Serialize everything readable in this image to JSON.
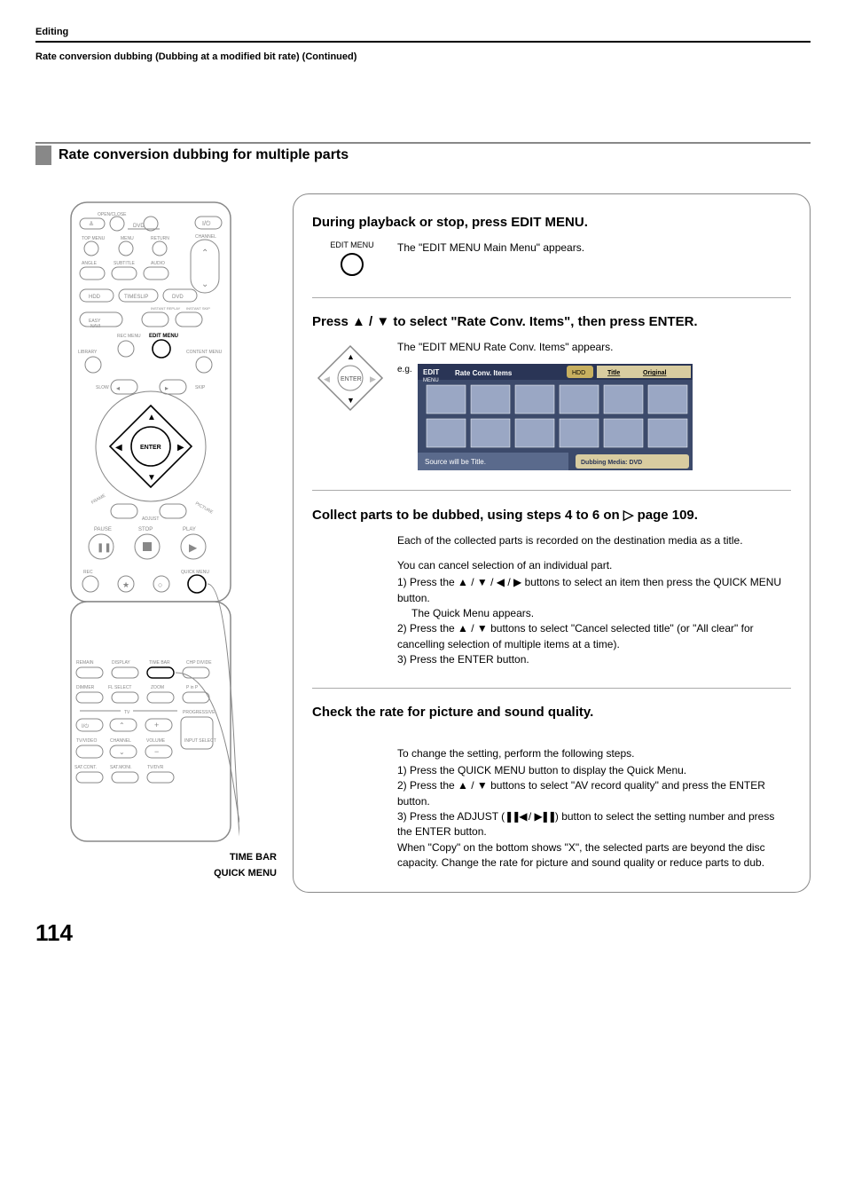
{
  "header": {
    "section": "Editing",
    "subtitle": "Rate conversion dubbing (Dubbing at a modified bit rate) (Continued)"
  },
  "mainHeading": "Rate conversion dubbing for multiple parts",
  "callouts": {
    "timeBar": "TIME BAR",
    "quickMenu": "QUICK MENU"
  },
  "remote": {
    "openClose": "OPEN/CLOSE",
    "dvd": "DVD",
    "topMenu": "TOP MENU",
    "menu": "MENU",
    "return": "RETURN",
    "angle": "ANGLE",
    "subtitle": "SUBTITLE",
    "audio": "AUDIO",
    "channel": "CHANNEL",
    "hdd": "HDD",
    "timeslip": "TIMESLIP",
    "dvd2": "DVD",
    "instantReplay": "INSTANT REPLAY",
    "instantSkip": "INSTANT SKIP",
    "easyNavi": "EASY NAVI",
    "recMenu": "REC MENU",
    "editMenu": "EDIT MENU",
    "library": "LIBRARY",
    "contentMenu": "CONTENT MENU",
    "slow": "SLOW",
    "skip": "SKIP",
    "enter": "ENTER",
    "frame": "FRAME",
    "adjust": "ADJUST",
    "pictureSearch": "PICTURE SEARCH",
    "pause": "PAUSE",
    "stop": "STOP",
    "play": "PLAY",
    "rec": "REC",
    "quickMenuBtn": "QUICK MENU",
    "remain": "REMAIN",
    "display": "DISPLAY",
    "timeBarBtn": "TIME BAR",
    "chpDivide": "CHP DIVIDE",
    "dimmer": "DIMMER",
    "flSelect": "FL SELECT",
    "zoom": "ZOOM",
    "pinp": "P in P",
    "tv": "TV",
    "progressive": "PROGRESSIVE",
    "tvVideo": "TV/VIDEO",
    "channel2": "CHANNEL",
    "volume": "VOLUME",
    "inputSelect": "INPUT SELECT",
    "satCont": "SAT.CONT.",
    "satMoni": "SAT.MONI.",
    "tvDvr": "TV/DVR"
  },
  "steps": [
    {
      "heading": "During playback or stop, press EDIT MENU.",
      "visualLabel": "EDIT MENU",
      "body": "The \"EDIT MENU Main Menu\" appears."
    },
    {
      "heading": "Press ▲ / ▼ to select \"Rate Conv. Items\", then press ENTER.",
      "visualLabel": "ENTER",
      "body": "The \"EDIT MENU Rate Conv. Items\" appears.",
      "egLabel": "e.g.",
      "preview": {
        "title1": "EDIT",
        "title2": "MENU",
        "menuName": "Rate Conv. Items",
        "hdd": "HDD",
        "titleTab": "Title",
        "originalTab": "Original",
        "statusBar": "Source will be Title.",
        "dubMedia": "Dubbing Media: DVD"
      }
    },
    {
      "heading": "Collect parts to be dubbed, using steps 4 to 6 on ▷ page 109.",
      "pageRef": "page 109.",
      "body1": "Each of the collected parts is recorded on the destination media as a title.",
      "body2": "You can cancel selection of an individual part.",
      "li1a": "1)  Press the ▲ / ▼ / ◀ / ▶ buttons to select an item then press the QUICK MENU button.",
      "li1b": "The Quick Menu appears.",
      "li2": "2)  Press the ▲ / ▼ buttons to select \"Cancel selected title\" (or \"All clear\" for cancelling selection of multiple items at a time).",
      "li3": "3)  Press the ENTER button."
    },
    {
      "heading": "Check the rate for picture and sound quality.",
      "body1": "To change the setting, perform the following steps.",
      "li1": "1)  Press the QUICK MENU button to display the Quick Menu.",
      "li2": "2)  Press the ▲ / ▼ buttons to select \"AV record quality\" and press the ENTER button.",
      "li3": "3)  Press the ADJUST (𝄢◀ / ▶𝄢) button to select the setting number and press the ENTER button.",
      "body2": "When \"Copy\" on the bottom shows \"X\", the selected parts are beyond the disc capacity. Change the rate for picture and sound quality or reduce parts to dub."
    }
  ],
  "pageNumber": "114",
  "icons": {
    "arrowRight": "▷"
  }
}
